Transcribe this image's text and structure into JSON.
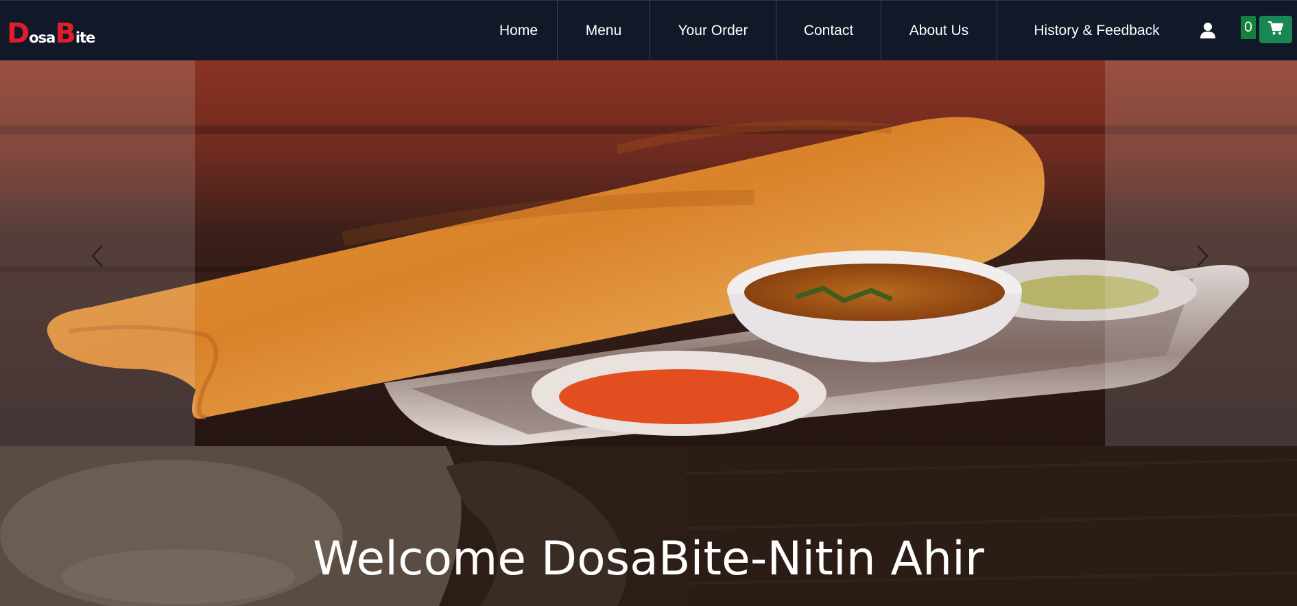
{
  "brand": {
    "logo_parts": [
      "D",
      "osa",
      "B",
      "ite"
    ]
  },
  "nav": {
    "items": [
      {
        "label": "Home"
      },
      {
        "label": "Menu"
      },
      {
        "label": "Your Order"
      },
      {
        "label": "Contact"
      },
      {
        "label": "About Us"
      },
      {
        "label": "History & Feedback"
      }
    ]
  },
  "cart": {
    "count": "0",
    "icon": "cart-icon"
  },
  "account": {
    "icon": "user-icon"
  },
  "carousel": {
    "prev_icon": "chevron-left-icon",
    "next_icon": "chevron-right-icon"
  },
  "welcome": {
    "title": "Welcome DosaBite-Nitin Ahir"
  },
  "colors": {
    "navbar_bg": "#111827",
    "brand_red": "#e11d2a",
    "cart_green": "#198754"
  }
}
